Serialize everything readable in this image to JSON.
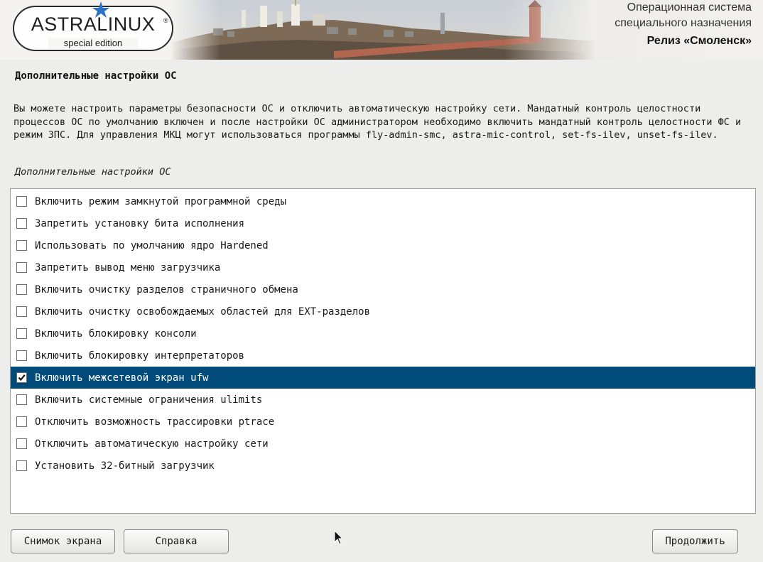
{
  "header": {
    "logo_text": "ASTRALINUX",
    "logo_registered": "®",
    "logo_subtitle": "special edition",
    "os_line1": "Операционная система",
    "os_line2": "специального назначения",
    "release": "Релиз «Смоленск»"
  },
  "page": {
    "title": "Дополнительные настройки ОС",
    "description": "Вы можете настроить параметры безопасности ОС и отключить автоматическую настройку сети. Мандатный контроль целостности процессов ОС по умолчанию включен и после настройки ОС администратором необходимо включить мандатный контроль целостности ФС и режим ЗПС. Для управления МКЦ могут использоваться программы fly-admin-smc, astra-mic-control, set-fs-ilev, unset-fs-ilev.",
    "section_label": "Дополнительные настройки ОС"
  },
  "options": [
    {
      "label": "Включить режим замкнутой программной среды",
      "checked": false,
      "selected": false
    },
    {
      "label": "Запретить установку бита исполнения",
      "checked": false,
      "selected": false
    },
    {
      "label": "Использовать по умолчанию ядро Hardened",
      "checked": false,
      "selected": false
    },
    {
      "label": "Запретить вывод меню загрузчика",
      "checked": false,
      "selected": false
    },
    {
      "label": "Включить очистку разделов страничного обмена",
      "checked": false,
      "selected": false
    },
    {
      "label": "Включить очистку освобождаемых областей для EXT-разделов",
      "checked": false,
      "selected": false
    },
    {
      "label": "Включить блокировку консоли",
      "checked": false,
      "selected": false
    },
    {
      "label": "Включить блокировку интерпретаторов",
      "checked": false,
      "selected": false
    },
    {
      "label": "Включить межсетевой экран ufw",
      "checked": true,
      "selected": true
    },
    {
      "label": "Включить системные ограничения ulimits",
      "checked": false,
      "selected": false
    },
    {
      "label": "Отключить возможность трассировки ptrace",
      "checked": false,
      "selected": false
    },
    {
      "label": "Отключить автоматическую настройку сети",
      "checked": false,
      "selected": false
    },
    {
      "label": "Установить 32-битный загрузчик",
      "checked": false,
      "selected": false
    }
  ],
  "buttons": {
    "screenshot": "Снимок экрана",
    "help": "Справка",
    "continue": "Продолжить"
  },
  "colors": {
    "selection": "#004b7a",
    "logo_star": "#2a73c6"
  }
}
